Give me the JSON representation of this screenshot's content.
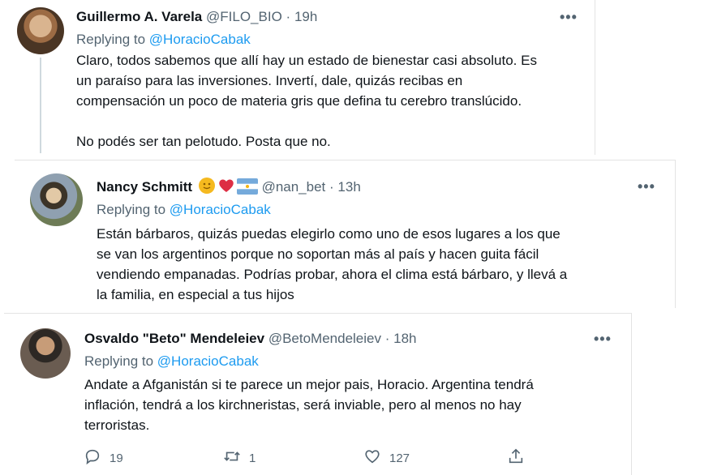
{
  "tweets": [
    {
      "name": "Guillermo A. Varela",
      "handle": "@FILO_BIO",
      "separator": "·",
      "time": "19h",
      "replying_prefix": "Replying to",
      "replying_to": "@HoracioCabak",
      "text": "Claro, todos sabemos que allí hay un estado de bienestar casi absoluto. Es\nun paraíso para las inversiones. Invertí, dale, quizás recibas en\ncompensación un poco de materia gris que defina tu cerebro translúcido.\n\nNo podés ser tan pelotudo. Posta que no.",
      "more": "•••"
    },
    {
      "name": "Nancy Schmitt",
      "name_emojis": [
        "sun-emoji",
        "red-heart-emoji",
        "argentina-flag-emoji"
      ],
      "handle": "@nan_bet",
      "separator": "·",
      "time": "13h",
      "replying_prefix": "Replying to",
      "replying_to": "@HoracioCabak",
      "text": "Están bárbaros, quizás puedas elegirlo como uno de esos lugares a los que\nse van los argentinos porque no soportan más al país y hacen guita fácil\nvendiendo empanadas. Podrías probar, ahora el clima está bárbaro, y llevá a\nla familia, en especial a tus hijos",
      "more": "•••"
    },
    {
      "name": "Osvaldo \"Beto\" Mendeleiev",
      "handle": "@BetoMendeleiev",
      "separator": "·",
      "time": "18h",
      "replying_prefix": "Replying to",
      "replying_to": "@HoracioCabak",
      "text": "Andate a Afganistán si te parece un mejor pais, Horacio. Argentina tendrá\ninflación, tendrá a los kirchneristas, será inviable, pero al menos no hay\nterroristas.",
      "more": "•••",
      "actions": {
        "reply_count": "19",
        "retweet_count": "1",
        "like_count": "127"
      }
    }
  ],
  "colors": {
    "text": "#0f1419",
    "secondary": "#536471",
    "link": "#1d9bf0",
    "thread_line": "#cfd9de"
  }
}
